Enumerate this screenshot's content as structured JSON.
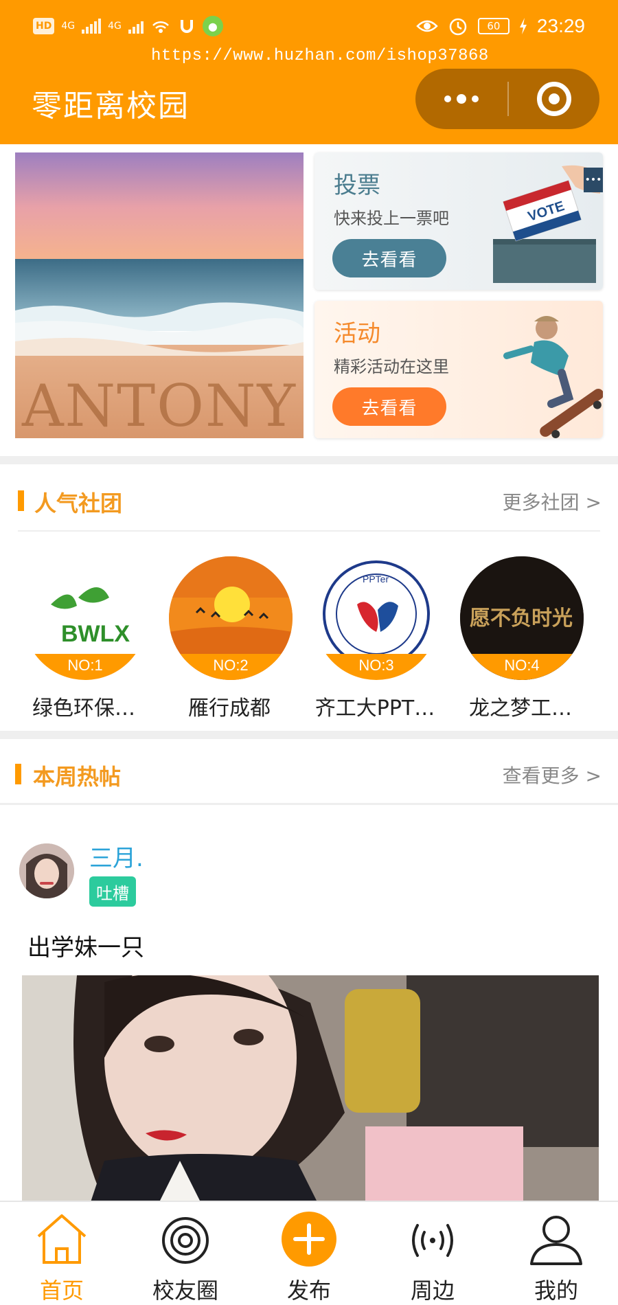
{
  "status_bar": {
    "left_items": [
      "HD",
      "4G",
      "4G"
    ],
    "battery": "60",
    "time": "23:29"
  },
  "watermark": "https://www.huzhan.com/ishop37868",
  "header": {
    "title": "零距离校园"
  },
  "banner": {
    "text": "ANTONY"
  },
  "cards": [
    {
      "title": "投票",
      "subtitle": "快来投上一票吧",
      "button": "去看看",
      "badge": "VOTE"
    },
    {
      "title": "活动",
      "subtitle": "精彩活动在这里",
      "button": "去看看"
    }
  ],
  "clubs_section": {
    "title": "人气社团",
    "more": "更多社团 >",
    "clubs": [
      {
        "rank": "NO:1",
        "name": "绿色环保…",
        "logo_text": "BWLX"
      },
      {
        "rank": "NO:2",
        "name": "雁行成都"
      },
      {
        "rank": "NO:3",
        "name": "齐工大PPT…",
        "logo_text": "PPTer"
      },
      {
        "rank": "NO:4",
        "name": "龙之梦工…",
        "logo_text": "愿不负时光"
      }
    ]
  },
  "hot_section": {
    "title": "本周热帖",
    "more": "查看更多 >"
  },
  "post": {
    "user": "三月.",
    "tag": "吐槽",
    "text": "出学妹一只"
  },
  "tabbar": {
    "active": "首页",
    "tabs": [
      {
        "label": "首页",
        "icon": "home-icon"
      },
      {
        "label": "校友圈",
        "icon": "circle-icon"
      },
      {
        "label": "发布",
        "icon": "plus-icon"
      },
      {
        "label": "周边",
        "icon": "radar-icon"
      },
      {
        "label": "我的",
        "icon": "user-icon"
      }
    ]
  },
  "colors": {
    "primary": "#FF9A00",
    "link": "#2BA3D8",
    "tag": "#2CCB9D"
  }
}
